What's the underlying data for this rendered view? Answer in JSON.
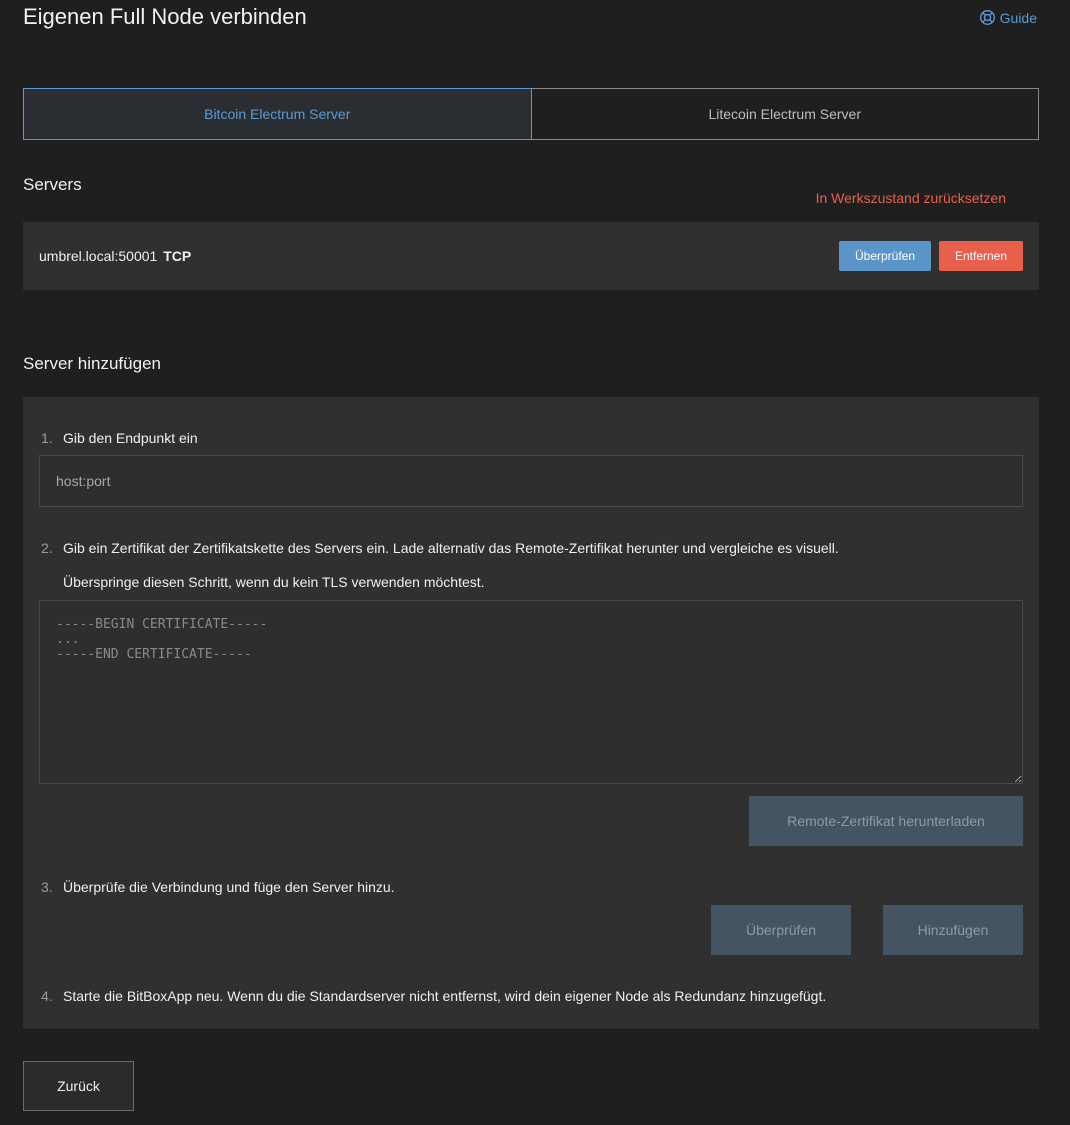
{
  "page": {
    "title": "Eigenen Full Node verbinden",
    "guide_label": "Guide",
    "guide_icon": "lifebuoy-icon"
  },
  "tabs": [
    {
      "label": "Bitcoin Electrum Server",
      "active": true
    },
    {
      "label": "Litecoin Electrum Server",
      "active": false
    }
  ],
  "servers": {
    "heading": "Servers",
    "reset_label": "In Werkszustand zurücksetzen",
    "items": [
      {
        "address": "umbrel.local:50001",
        "protocol": "TCP",
        "check_label": "Überprüfen",
        "remove_label": "Entfernen"
      }
    ]
  },
  "add_server": {
    "heading": "Server hinzufügen",
    "step1": {
      "num": "1.",
      "text": "Gib den Endpunkt ein",
      "placeholder": "host:port"
    },
    "step2": {
      "num": "2.",
      "text": "Gib ein Zertifikat der Zertifikatskette des Servers ein. Lade alternativ das Remote-Zertifikat herunter und vergleiche es visuell.",
      "subtext": "Überspringe diesen Schritt, wenn du kein TLS verwenden möchtest.",
      "placeholder": "-----BEGIN CERTIFICATE-----\n...\n-----END CERTIFICATE-----",
      "download_label": "Remote-Zertifikat herunterladen"
    },
    "step3": {
      "num": "3.",
      "text": "Überprüfe die Verbindung und füge den Server hinzu.",
      "check_label": "Überprüfen",
      "add_label": "Hinzufügen"
    },
    "step4": {
      "num": "4.",
      "text": "Starte die BitBoxApp neu. Wenn du die Standardserver nicht entfernst, wird dein eigener Node als Redundanz hinzugefügt."
    }
  },
  "footer": {
    "back_label": "Zurück"
  },
  "colors": {
    "background": "#1f1f1f",
    "panel": "#303030",
    "accent_blue": "#5b9bd5",
    "danger_red": "#e8604c",
    "disabled_button": "#455463"
  }
}
